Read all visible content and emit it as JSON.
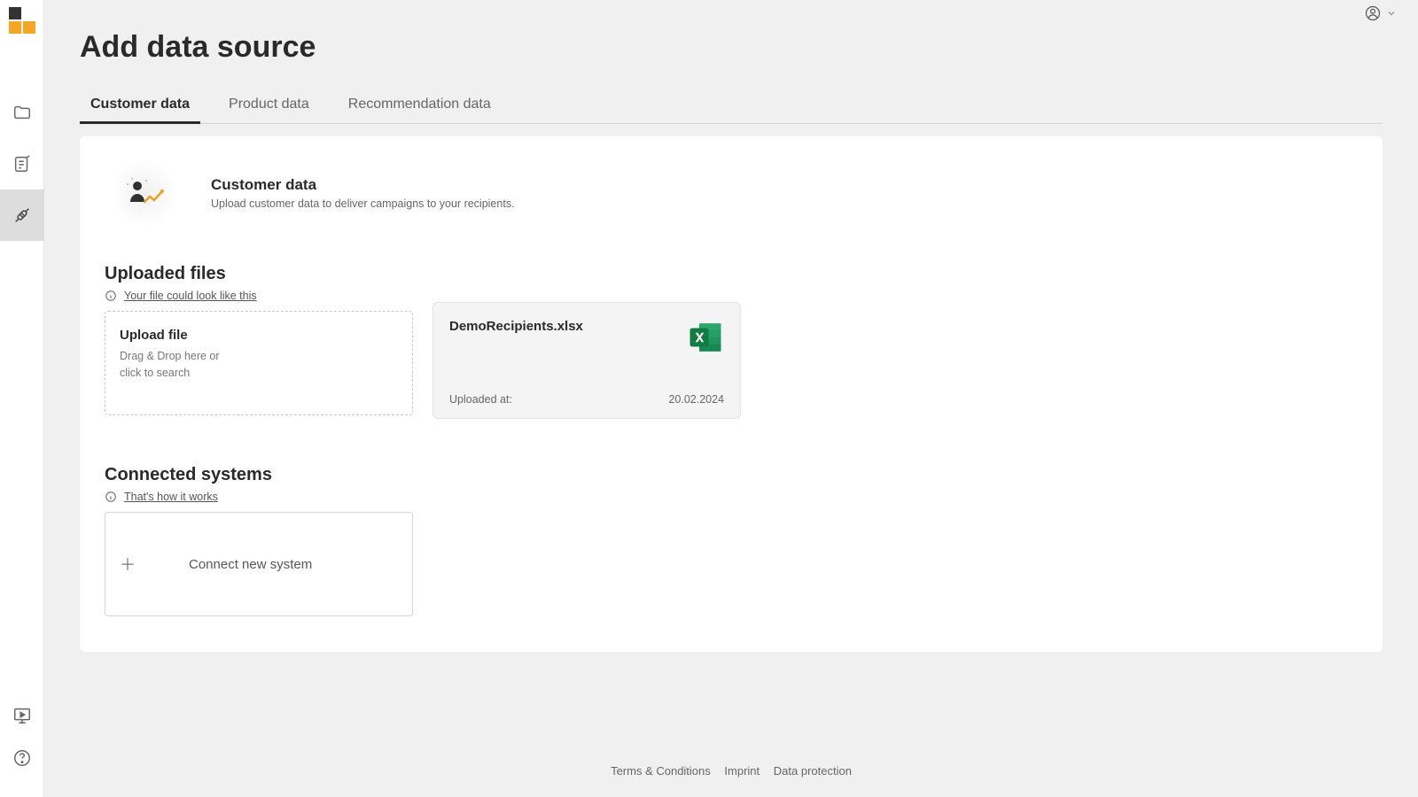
{
  "page": {
    "title": "Add data source"
  },
  "tabs": [
    {
      "label": "Customer data"
    },
    {
      "label": "Product data"
    },
    {
      "label": "Recommendation data"
    }
  ],
  "customer_header": {
    "title": "Customer data",
    "subtitle": "Upload customer data to deliver campaigns to your recipients."
  },
  "uploaded_files": {
    "section_title": "Uploaded files",
    "hint": "Your file could look like this",
    "upload_card": {
      "title": "Upload file",
      "line1": "Drag & Drop here or",
      "line2": "click to search"
    },
    "files": [
      {
        "name": "DemoRecipients.xlsx",
        "uploaded_at_label": "Uploaded at:",
        "uploaded_at": "20.02.2024"
      }
    ]
  },
  "connected_systems": {
    "section_title": "Connected systems",
    "hint": "That's how it works",
    "connect_label": "Connect new system"
  },
  "footer": {
    "terms": "Terms & Conditions",
    "imprint": "Imprint",
    "data_protection": "Data protection"
  }
}
